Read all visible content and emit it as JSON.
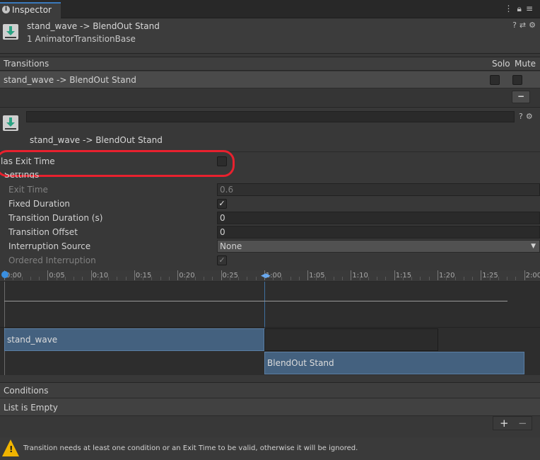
{
  "tab": {
    "title": "Inspector",
    "icon": "info-icon"
  },
  "header": {
    "title": "stand_wave -> BlendOut Stand",
    "subtitle": "1 AnimatorTransitionBase"
  },
  "transitions": {
    "title": "Transitions",
    "solo": "Solo",
    "mute": "Mute",
    "row": "stand_wave -> BlendOut Stand",
    "remove": "−"
  },
  "detail": {
    "name_value": "",
    "label": "stand_wave -> BlendOut Stand"
  },
  "has_exit_time": {
    "label": "Has Exit Time",
    "visible_label": "las Exit Time",
    "checked": false
  },
  "settings": {
    "title": "Settings",
    "exit_time": {
      "label": "Exit Time",
      "value": "0.6"
    },
    "fixed_duration": {
      "label": "Fixed Duration",
      "checked": true
    },
    "transition_duration": {
      "label": "Transition Duration (s)",
      "value": "0"
    },
    "transition_offset": {
      "label": "Transition Offset",
      "value": "0"
    },
    "interruption_source": {
      "label": "Interruption Source",
      "value": "None"
    },
    "ordered_interruption": {
      "label": "Ordered Interruption",
      "checked": true
    }
  },
  "timeline": {
    "ticks": [
      "0:00",
      "0:05",
      "0:10",
      "0:15",
      "0:20",
      "0:25",
      "1:00",
      "1:05",
      "1:10",
      "1:15",
      "1:20",
      "1:25",
      "2:00"
    ],
    "track1": "stand_wave",
    "track2": "BlendOut Stand"
  },
  "conditions": {
    "title": "Conditions",
    "empty": "List is Empty",
    "add": "+",
    "remove": "−"
  },
  "warning": {
    "text": "Transition needs at least one condition or an Exit Time to be valid, otherwise it will be ignored."
  },
  "colors": {
    "accent": "#3a79bb",
    "highlight_ring": "#e8212e",
    "track": "#44617f",
    "warning": "#f0b400"
  }
}
